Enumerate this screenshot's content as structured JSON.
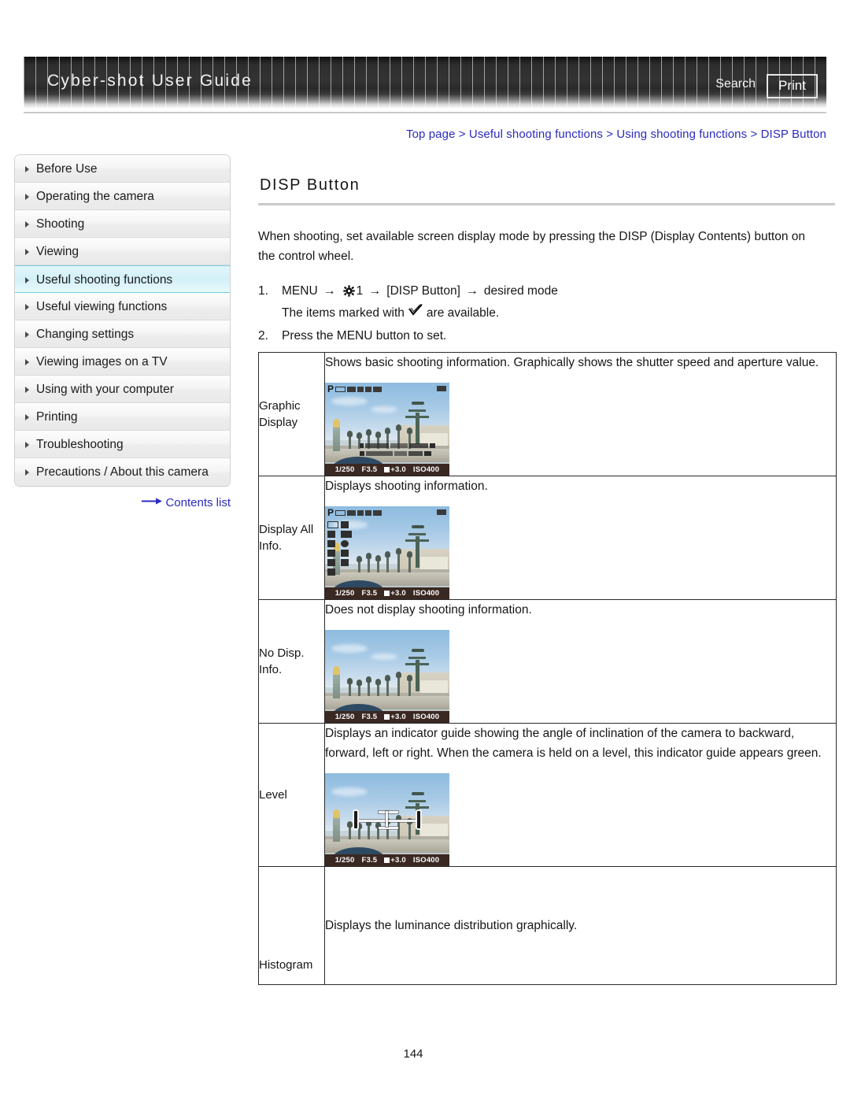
{
  "header": {
    "title": "Cyber-shot User Guide",
    "search_label": "Search",
    "print_label": "Print"
  },
  "breadcrumb": {
    "text": "Top page > Useful shooting functions > Using shooting functions > DISP Button"
  },
  "sidebar": {
    "items": [
      {
        "label": "Before Use",
        "active": false
      },
      {
        "label": "Operating the camera",
        "active": false
      },
      {
        "label": "Shooting",
        "active": false
      },
      {
        "label": "Viewing",
        "active": false
      },
      {
        "label": "Useful shooting functions",
        "active": true
      },
      {
        "label": "Useful viewing functions",
        "active": false
      },
      {
        "label": "Changing settings",
        "active": false
      },
      {
        "label": "Viewing images on a TV",
        "active": false
      },
      {
        "label": "Using with your computer",
        "active": false
      },
      {
        "label": "Printing",
        "active": false
      },
      {
        "label": "Troubleshooting",
        "active": false
      },
      {
        "label": "Precautions / About this camera",
        "active": false
      }
    ],
    "contents_link": "Contents list"
  },
  "main": {
    "page_title": "DISP Button",
    "intro": "When shooting, set available screen display mode by pressing the DISP (Display Contents) button on the control wheel.",
    "step1": {
      "num": "1.",
      "part_menu": "MENU",
      "gear_num": "1",
      "part_disp": "[DISP Button]",
      "part_mode": "desired mode",
      "arrow": "→",
      "note_before": "The items marked with",
      "note_after": "are available."
    },
    "step2": {
      "num": "2.",
      "text": "Press the MENU button to set."
    }
  },
  "table": {
    "rows": [
      {
        "label": "Graphic Display",
        "desc": "Shows basic shooting information. Graphically shows the shutter speed and aperture value.",
        "variant": "graphic"
      },
      {
        "label": "Display All Info.",
        "desc": "Displays shooting information.",
        "variant": "allinfo"
      },
      {
        "label": "No Disp. Info.",
        "desc": "Does not display shooting information.",
        "variant": "nodisp"
      },
      {
        "label": "Level",
        "desc": "Displays an indicator guide showing the angle of inclination of the camera to backward, forward, left or right. When the camera is held on a level, this indicator guide appears green.",
        "variant": "level"
      },
      {
        "label": "Histogram",
        "desc": "Displays the luminance distribution graphically.",
        "variant": "histogram"
      }
    ]
  },
  "camera_osd": {
    "mode": "P",
    "shutter": "1/250",
    "aperture": "F3.5",
    "ev": "+3.0",
    "iso": "ISO400"
  },
  "footer": {
    "page_number": "144"
  },
  "colors": {
    "link": "#2b2bc0",
    "banner_dark": "#333333",
    "sidebar_active_bg": "#d3f0f8",
    "sidebar_active_border": "#6fd0e6",
    "table_border": "#2a2a2a"
  }
}
